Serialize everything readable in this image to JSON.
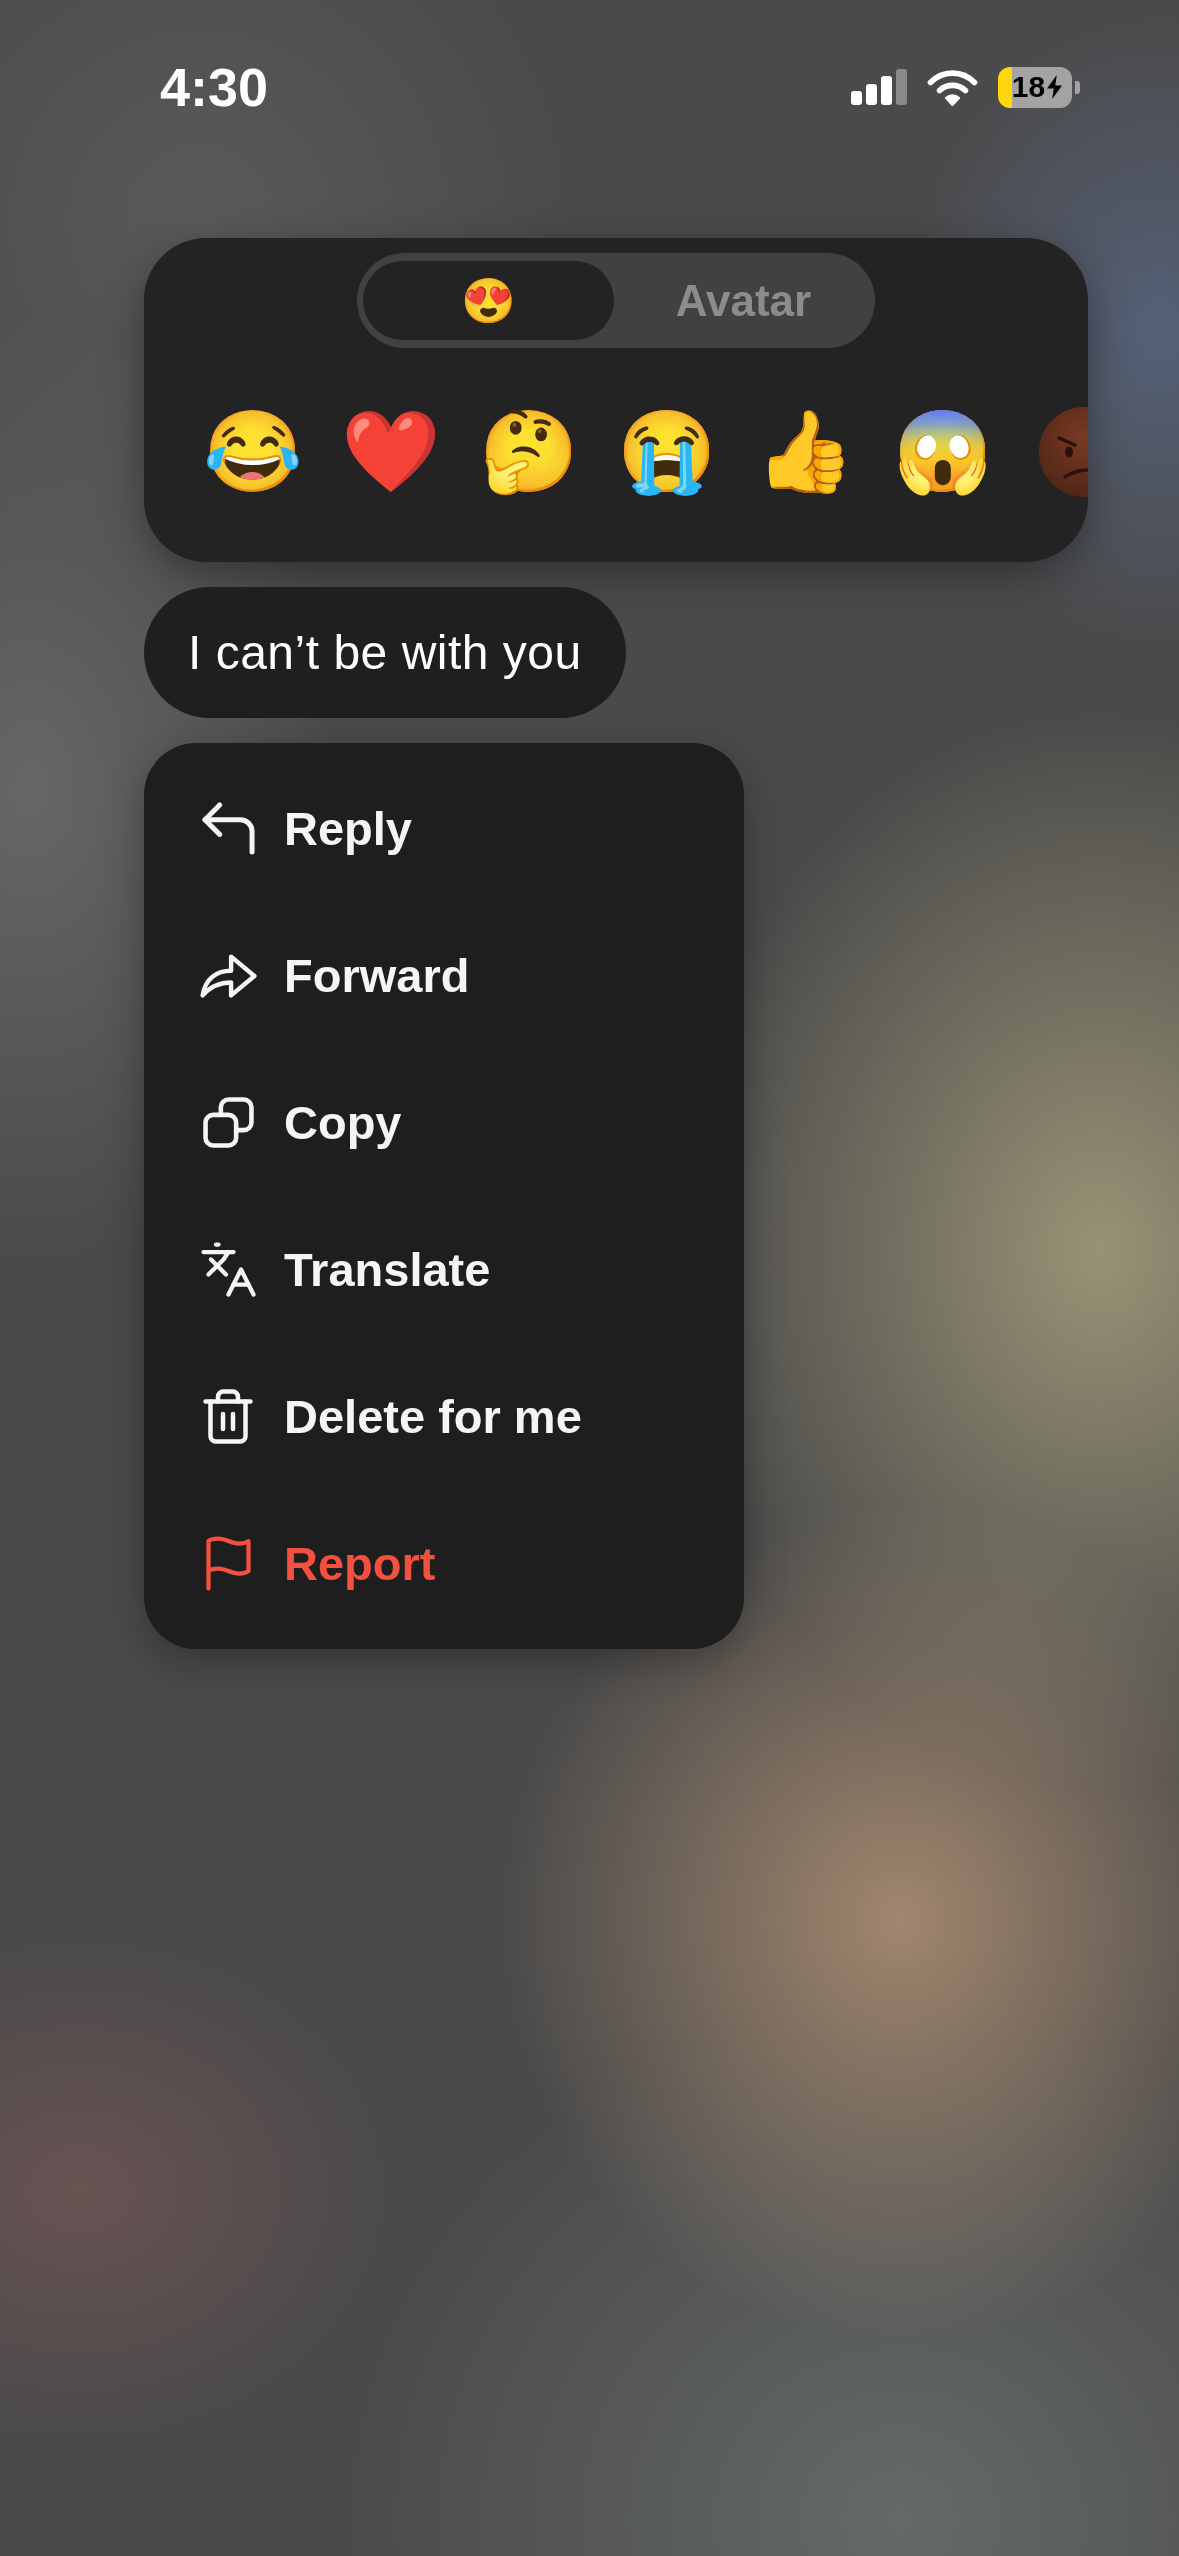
{
  "status_bar": {
    "time": "4:30",
    "battery": "18"
  },
  "reaction_picker": {
    "tabs": [
      {
        "label": "😍",
        "selected": true
      },
      {
        "label": "Avatar",
        "selected": false
      }
    ],
    "reactions": [
      "😂",
      "❤️",
      "🤔",
      "😭",
      "👍",
      "😱"
    ]
  },
  "message": {
    "text": "I can’t be with you"
  },
  "context_menu": {
    "items": [
      {
        "label": "Reply",
        "destructive": false
      },
      {
        "label": "Forward",
        "destructive": false
      },
      {
        "label": "Copy",
        "destructive": false
      },
      {
        "label": "Translate",
        "destructive": false
      },
      {
        "label": "Delete for me",
        "destructive": false
      },
      {
        "label": "Report",
        "destructive": true
      }
    ]
  }
}
